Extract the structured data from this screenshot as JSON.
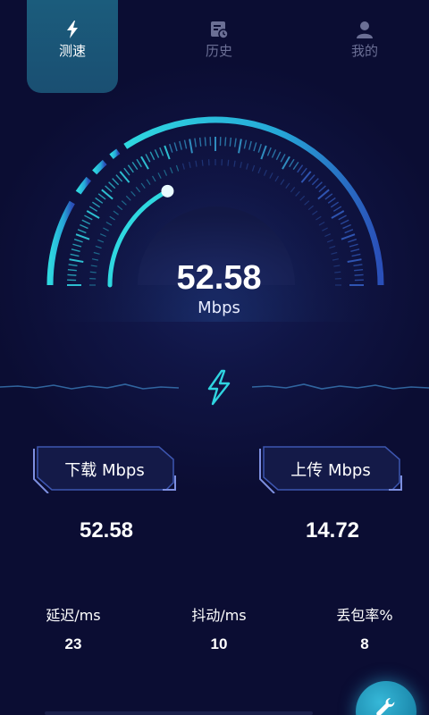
{
  "tabs": [
    {
      "label": "测速",
      "icon": "bolt-icon",
      "active": true
    },
    {
      "label": "历史",
      "icon": "calendar-clock-icon",
      "active": false
    },
    {
      "label": "我的",
      "icon": "user-icon",
      "active": false
    }
  ],
  "gauge": {
    "value": "52.58",
    "unit": "Mbps",
    "level": 0.35
  },
  "results": {
    "download": {
      "label": "下载 Mbps",
      "value": "52.58"
    },
    "upload": {
      "label": "上传 Mbps",
      "value": "14.72"
    }
  },
  "stats": [
    {
      "label": "延迟/ms",
      "value": "23"
    },
    {
      "label": "抖动/ms",
      "value": "10"
    },
    {
      "label": "丢包率%",
      "value": "8"
    }
  ],
  "fab": {
    "icon": "wrench-icon"
  },
  "colors": {
    "background": "#0b0d33",
    "accent": "#2fd4e0",
    "tab_active_bg": "#1b5c7c",
    "tab_inactive_text": "#6b6f95"
  }
}
